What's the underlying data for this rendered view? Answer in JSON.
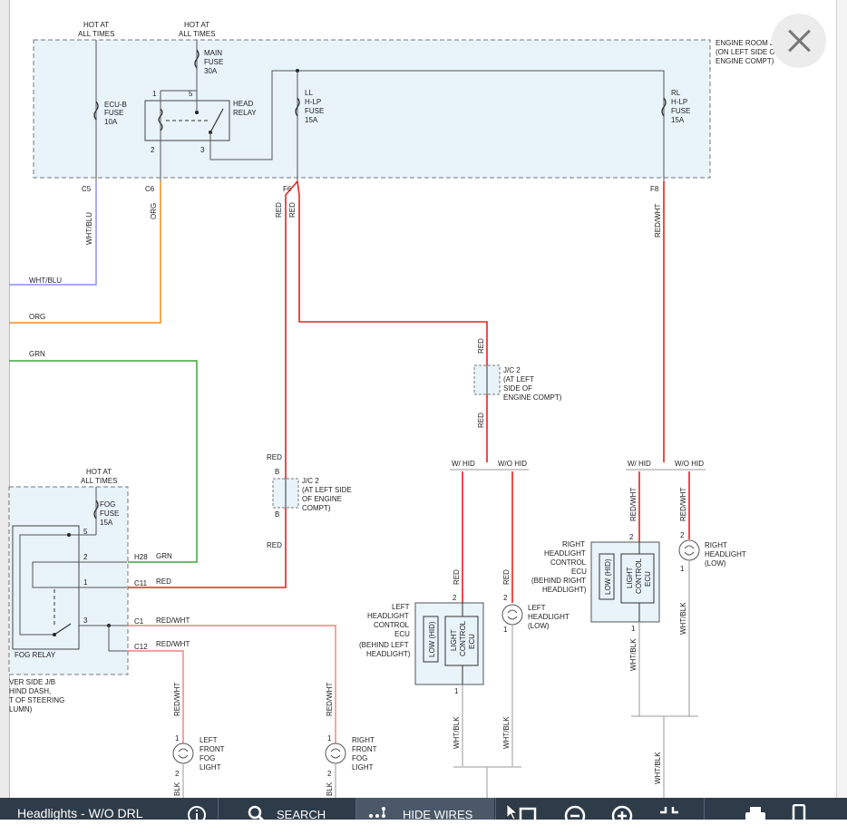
{
  "labels": {
    "hot1": "HOT AT",
    "hot1b": "ALL TIMES",
    "hot2": "HOT AT",
    "hot2b": "ALL TIMES",
    "engine_room_1": "ENGINE ROOM J/B",
    "engine_room_2": "(ON LEFT SIDE OF",
    "engine_room_3": "ENGINE COMPT)",
    "main_fuse_1": "MAIN",
    "main_fuse_2": "FUSE",
    "main_fuse_3": "30A",
    "ecub_1": "ECU-B",
    "ecub_2": "FUSE",
    "ecub_3": "10A",
    "head_relay_1": "HEAD",
    "head_relay_2": "RELAY",
    "ll_1": "LL",
    "ll_2": "H-LP",
    "ll_3": "FUSE",
    "ll_4": "15A",
    "rl_1": "RL",
    "rl_2": "H-LP",
    "rl_3": "FUSE",
    "rl_4": "15A",
    "pin1": "1",
    "pin5": "5",
    "pin2": "2",
    "pin3": "3",
    "c5": "C5",
    "c6": "C6",
    "f6": "F6",
    "f8": "F8",
    "wht_blu_v": "WHT/BLU",
    "org_v": "ORG",
    "red_v1": "RED",
    "red_v2": "RED",
    "red_wht_v": "RED/WHT",
    "wht_blu_h": "WHT/BLU",
    "org_h": "ORG",
    "grn_h": "GRN",
    "red_jc_top": "RED",
    "red_jc_bot": "RED",
    "jc2a_1": "J/C 2",
    "jc2a_2": "(AT LEFT",
    "jc2a_3": "SIDE OF",
    "jc2a_4": "ENGINE COMPT)",
    "w_hid_l": "W/ HID",
    "wo_hid_l": "W/O HID",
    "w_hid_r": "W/ HID",
    "wo_hid_r": "W/O HID",
    "hot3": "HOT AT",
    "hot3b": "ALL TIMES",
    "fog_fuse_1": "FOG",
    "fog_fuse_2": "FUSE",
    "fog_fuse_3": "15A",
    "h28": "H28",
    "c11": "C11",
    "c1": "C1",
    "c12": "C12",
    "grn_fog": "GRN",
    "red_fog": "RED",
    "redwht_c1": "RED/WHT",
    "redwht_c12": "RED/WHT",
    "fog_relay": "FOG RELAY",
    "driver_1": "VER SIDE J/B",
    "driver_2": "HIND DASH,",
    "driver_3": "T OF STEERING",
    "driver_4": "LUMN)",
    "red_b_top": "RED",
    "b_top": "B",
    "b_bot": "B",
    "jc2b_1": "J/C 2",
    "jc2b_2": "(AT LEFT SIDE",
    "jc2b_3": "OF ENGINE",
    "jc2b_4": "COMPT)",
    "red_b_bot": "RED",
    "redwht_lff": "RED/WHT",
    "redwht_rff": "RED/WHT",
    "lff_1": "LEFT",
    "lff_2": "FRONT",
    "lff_3": "FOG",
    "lff_4": "LIGHT",
    "rff_1": "RIGHT",
    "rff_2": "FRONT",
    "rff_3": "FOG",
    "rff_4": "LIGHT",
    "lff_blk": "BLK",
    "rff_blk": "BLK",
    "red_lh_ecu": "RED",
    "red_lh_low": "RED",
    "lhecu_1": "LEFT",
    "lhecu_2": "HEADLIGHT",
    "lhecu_3": "CONTROL",
    "lhecu_4": "ECU",
    "lhecu_5": "(BEHIND LEFT",
    "lhecu_6": "HEADLIGHT)",
    "low_hid": "LOW (HID)",
    "light_control": "LIGHT",
    "light_control2": "CONTROL",
    "light_control3": "ECU",
    "lhlow_1": "LEFT",
    "lhlow_2": "HEADLIGHT",
    "lhlow_3": "(LOW)",
    "whtblk_1": "WHT/BLK",
    "whtblk_2": "WHT/BLK",
    "redwht_rh_ecu": "RED/WHT",
    "redwht_rh_low": "RED/WHT",
    "rhecu_1": "RIGHT",
    "rhecu_2": "HEADLIGHT",
    "rhecu_3": "CONTROL",
    "rhecu_4": "ECU",
    "rhecu_5": "(BEHIND RIGHT",
    "rhecu_6": "HEADLIGHT)",
    "rhlow_1": "RIGHT",
    "rhlow_2": "HEADLIGHT",
    "rhlow_3": "(LOW)",
    "whtblk_3": "WHT/BLK",
    "whtblk_4": "WHT/BLK",
    "whtblk_5": "WHT/BLK"
  },
  "toolbar": {
    "title": "Headlights - W/O DRL",
    "search": "SEARCH",
    "hide_wires": "HIDE WIRES"
  },
  "colors": {
    "wire_red": "#e8201c",
    "wire_red_light": "#e86a6a",
    "wire_org": "#f08c1e",
    "wire_grn": "#3aa53a",
    "wire_blu": "#8f8ff0",
    "box_fill": "#e8f3fa",
    "toolbar": "#2e3b49"
  }
}
